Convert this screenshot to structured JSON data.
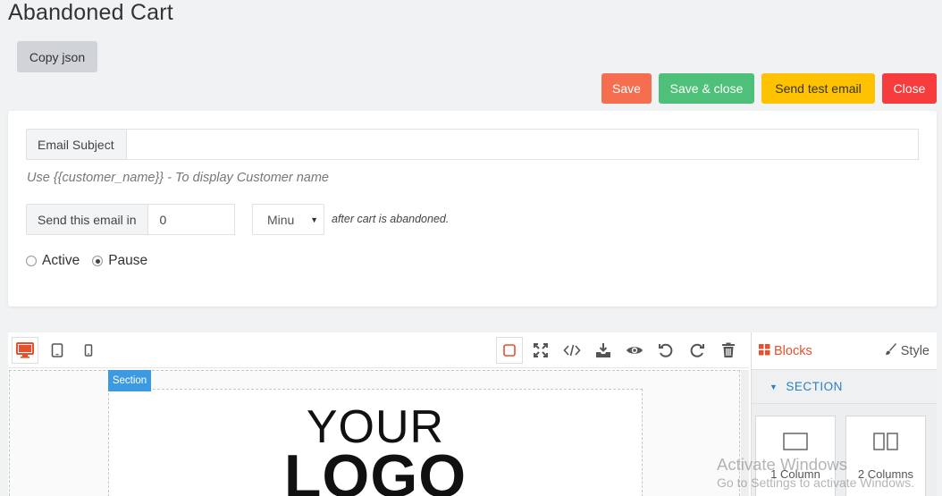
{
  "page": {
    "title": "Abandoned Cart"
  },
  "actions": {
    "copy_json": "Copy json",
    "save": "Save",
    "save_close": "Save & close",
    "send_test": "Send test email",
    "close": "Close"
  },
  "form": {
    "subject_label": "Email Subject",
    "subject_value": "",
    "hint": "Use {{customer_name}} - To display Customer name",
    "send_label": "Send this email in",
    "send_value": "0",
    "unit_selected": "Minu",
    "after_text": "after cart is abandoned.",
    "status_options": [
      {
        "label": "Active",
        "checked": false
      },
      {
        "label": "Pause",
        "checked": true
      }
    ]
  },
  "editor": {
    "section_tag": "Section",
    "logo_line1": "YOUR",
    "logo_line2": "LOGO",
    "panel_tabs": {
      "blocks": "Blocks",
      "style": "Style"
    },
    "category": "SECTION",
    "blocks": [
      {
        "label": "1 Column"
      },
      {
        "label": "2 Columns"
      }
    ]
  },
  "watermark": {
    "line1": "Activate Windows",
    "line2": "Go to Settings to activate Windows."
  },
  "colors": {
    "save": "#f56e4f",
    "save_close": "#4fc07a",
    "send_test": "#fec200",
    "close": "#f63c3c",
    "accent": "#e6502c",
    "section_tag": "#3c9ae2"
  }
}
